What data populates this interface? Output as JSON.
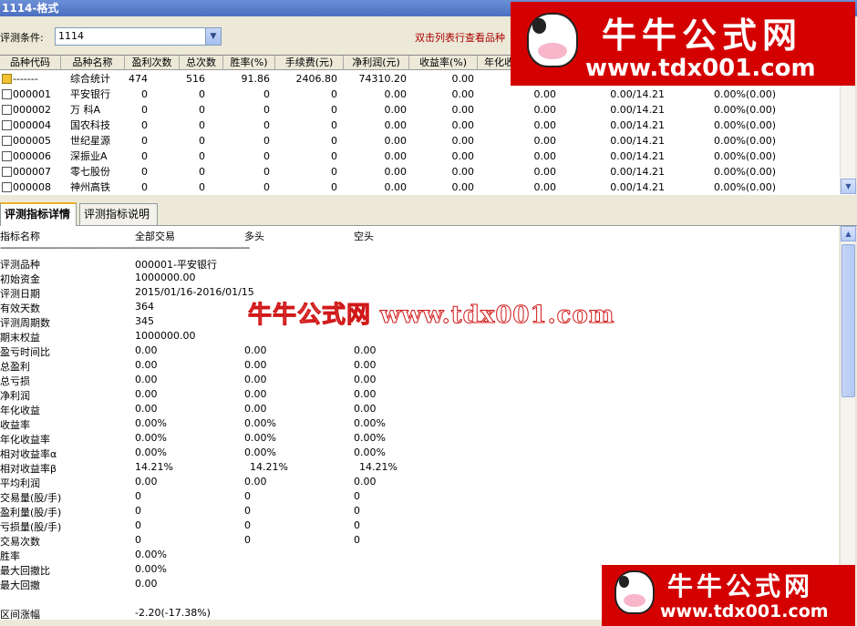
{
  "window": {
    "title": "1114-格式"
  },
  "condition": {
    "label": "评测条件:",
    "value": "1114"
  },
  "hint": "双击列表行查看品种",
  "grid": {
    "columns": [
      {
        "label": "品种代码"
      },
      {
        "label": "品种名称"
      },
      {
        "label": "盈利次数"
      },
      {
        "label": "总次数"
      },
      {
        "label": "胜率(%)"
      },
      {
        "label": "手续费(元)"
      },
      {
        "label": "净利润(元)"
      },
      {
        "label": "收益率(%)"
      },
      {
        "label": "年化收"
      }
    ],
    "rows": [
      {
        "code": "-------",
        "name": "综合统计",
        "win": "474",
        "total": "516",
        "rate": "91.86",
        "fee": "2406.80",
        "profit": "74310.20",
        "ret": "0.00",
        "c9": "",
        "c10": "",
        "c11": ""
      },
      {
        "code": "000001",
        "name": "平安银行",
        "win": "0",
        "total": "0",
        "rate": "0",
        "fee": "0",
        "profit": "0.00",
        "ret": "0.00",
        "c9": "0.00",
        "c10": "0.00/14.21",
        "c11": "0.00%(0.00)"
      },
      {
        "code": "000002",
        "name": "万  科A",
        "win": "0",
        "total": "0",
        "rate": "0",
        "fee": "0",
        "profit": "0.00",
        "ret": "0.00",
        "c9": "0.00",
        "c10": "0.00/14.21",
        "c11": "0.00%(0.00)"
      },
      {
        "code": "000004",
        "name": "国农科技",
        "win": "0",
        "total": "0",
        "rate": "0",
        "fee": "0",
        "profit": "0.00",
        "ret": "0.00",
        "c9": "0.00",
        "c10": "0.00/14.21",
        "c11": "0.00%(0.00)"
      },
      {
        "code": "000005",
        "name": "世纪星源",
        "win": "0",
        "total": "0",
        "rate": "0",
        "fee": "0",
        "profit": "0.00",
        "ret": "0.00",
        "c9": "0.00",
        "c10": "0.00/14.21",
        "c11": "0.00%(0.00)"
      },
      {
        "code": "000006",
        "name": "深振业A",
        "win": "0",
        "total": "0",
        "rate": "0",
        "fee": "0",
        "profit": "0.00",
        "ret": "0.00",
        "c9": "0.00",
        "c10": "0.00/14.21",
        "c11": "0.00%(0.00)"
      },
      {
        "code": "000007",
        "name": "零七股份",
        "win": "0",
        "total": "0",
        "rate": "0",
        "fee": "0",
        "profit": "0.00",
        "ret": "0.00",
        "c9": "0.00",
        "c10": "0.00/14.21",
        "c11": "0.00%(0.00)"
      },
      {
        "code": "000008",
        "name": "神州高铁",
        "win": "0",
        "total": "0",
        "rate": "0",
        "fee": "0",
        "profit": "0.00",
        "ret": "0.00",
        "c9": "0.00",
        "c10": "0.00/14.21",
        "c11": "0.00%(0.00)"
      }
    ]
  },
  "tabs": [
    {
      "label": "评测指标详情"
    },
    {
      "label": "评测指标说明"
    }
  ],
  "detail": {
    "headers": [
      "指标名称",
      "全部交易",
      "多头",
      "空头"
    ],
    "separator": "--------------------------------------------------------------------------------------------",
    "rows": [
      {
        "name": "评测品种",
        "all": "000001-平安银行",
        "long": "",
        "short": ""
      },
      {
        "name": "初始资金",
        "all": "1000000.00",
        "long": "",
        "short": ""
      },
      {
        "name": "评测日期",
        "all": "2015/01/16-2016/01/15",
        "long": "",
        "short": ""
      },
      {
        "name": "有效天数",
        "all": "364",
        "long": "",
        "short": ""
      },
      {
        "name": "评测周期数",
        "all": "345",
        "long": "",
        "short": ""
      },
      {
        "name": "期末权益",
        "all": "1000000.00",
        "long": "",
        "short": ""
      },
      {
        "name": "盈亏时间比",
        "all": "0.00",
        "long": "0.00",
        "short": "0.00"
      },
      {
        "name": "总盈利",
        "all": "0.00",
        "long": "0.00",
        "short": "0.00"
      },
      {
        "name": "总亏损",
        "all": "0.00",
        "long": "0.00",
        "short": "0.00"
      },
      {
        "name": "净利润",
        "all": "0.00",
        "long": "0.00",
        "short": "0.00"
      },
      {
        "name": "年化收益",
        "all": "0.00",
        "long": "0.00",
        "short": "0.00"
      },
      {
        "name": "收益率",
        "all": "0.00%",
        "long": "0.00%",
        "short": "0.00%"
      },
      {
        "name": "年化收益率",
        "all": "0.00%",
        "long": "0.00%",
        "short": "0.00%"
      },
      {
        "name": "相对收益率α",
        "all": "0.00%",
        "long": "0.00%",
        "short": "0.00%"
      },
      {
        "name": "相对收益率β",
        "all": "14.21%",
        "long": "14.21%",
        "short": "14.21%"
      },
      {
        "name": "平均利润",
        "all": "0.00",
        "long": "0.00",
        "short": "0.00"
      },
      {
        "name": "交易量(股/手)",
        "all": "0",
        "long": "0",
        "short": "0"
      },
      {
        "name": "盈利量(股/手)",
        "all": "0",
        "long": "0",
        "short": "0"
      },
      {
        "name": "亏损量(股/手)",
        "all": "0",
        "long": "0",
        "short": "0"
      },
      {
        "name": "交易次数",
        "all": "0",
        "long": "0",
        "short": "0"
      },
      {
        "name": "胜率",
        "all": "0.00%",
        "long": "",
        "short": ""
      },
      {
        "name": "最大回撤比",
        "all": "0.00%",
        "long": "",
        "short": ""
      },
      {
        "name": "最大回撤",
        "all": "0.00",
        "long": "",
        "short": ""
      },
      {
        "name": "",
        "all": "",
        "long": "",
        "short": ""
      },
      {
        "name": "区间涨幅",
        "all": "-2.20(-17.38%)",
        "long": "",
        "short": ""
      }
    ]
  },
  "watermark": {
    "cn": "牛牛公式网",
    "url": "www.tdx001.com",
    "mid": "牛牛公式网 www.tdx001.com"
  },
  "colors": {
    "brand": "#d40000",
    "titlebar": "#4b6fc0",
    "hint": "#aa0000"
  }
}
